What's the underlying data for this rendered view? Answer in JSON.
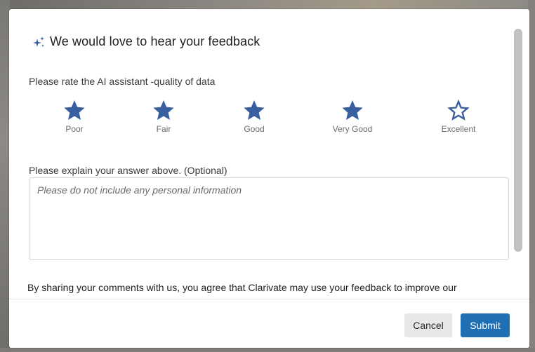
{
  "dialog": {
    "title": "We would love to hear your feedback",
    "title_icon": "sparkle-icon",
    "rating": {
      "label": "Please rate the AI assistant -quality of data",
      "selected_value": 4,
      "max": 5,
      "filled_color": "#3a5fa0",
      "options": [
        {
          "label": "Poor",
          "filled": true
        },
        {
          "label": "Fair",
          "filled": true
        },
        {
          "label": "Good",
          "filled": true
        },
        {
          "label": "Very Good",
          "filled": true
        },
        {
          "label": "Excellent",
          "filled": false
        }
      ]
    },
    "explain": {
      "label": "Please explain your answer above. (Optional)",
      "placeholder": "Please do not include any personal information",
      "value": ""
    },
    "consent_text": "By sharing your comments with us, you agree that Clarivate may use your feedback to improve our"
  },
  "footer": {
    "cancel_label": "Cancel",
    "submit_label": "Submit",
    "submit_color": "#1f6fb5"
  }
}
